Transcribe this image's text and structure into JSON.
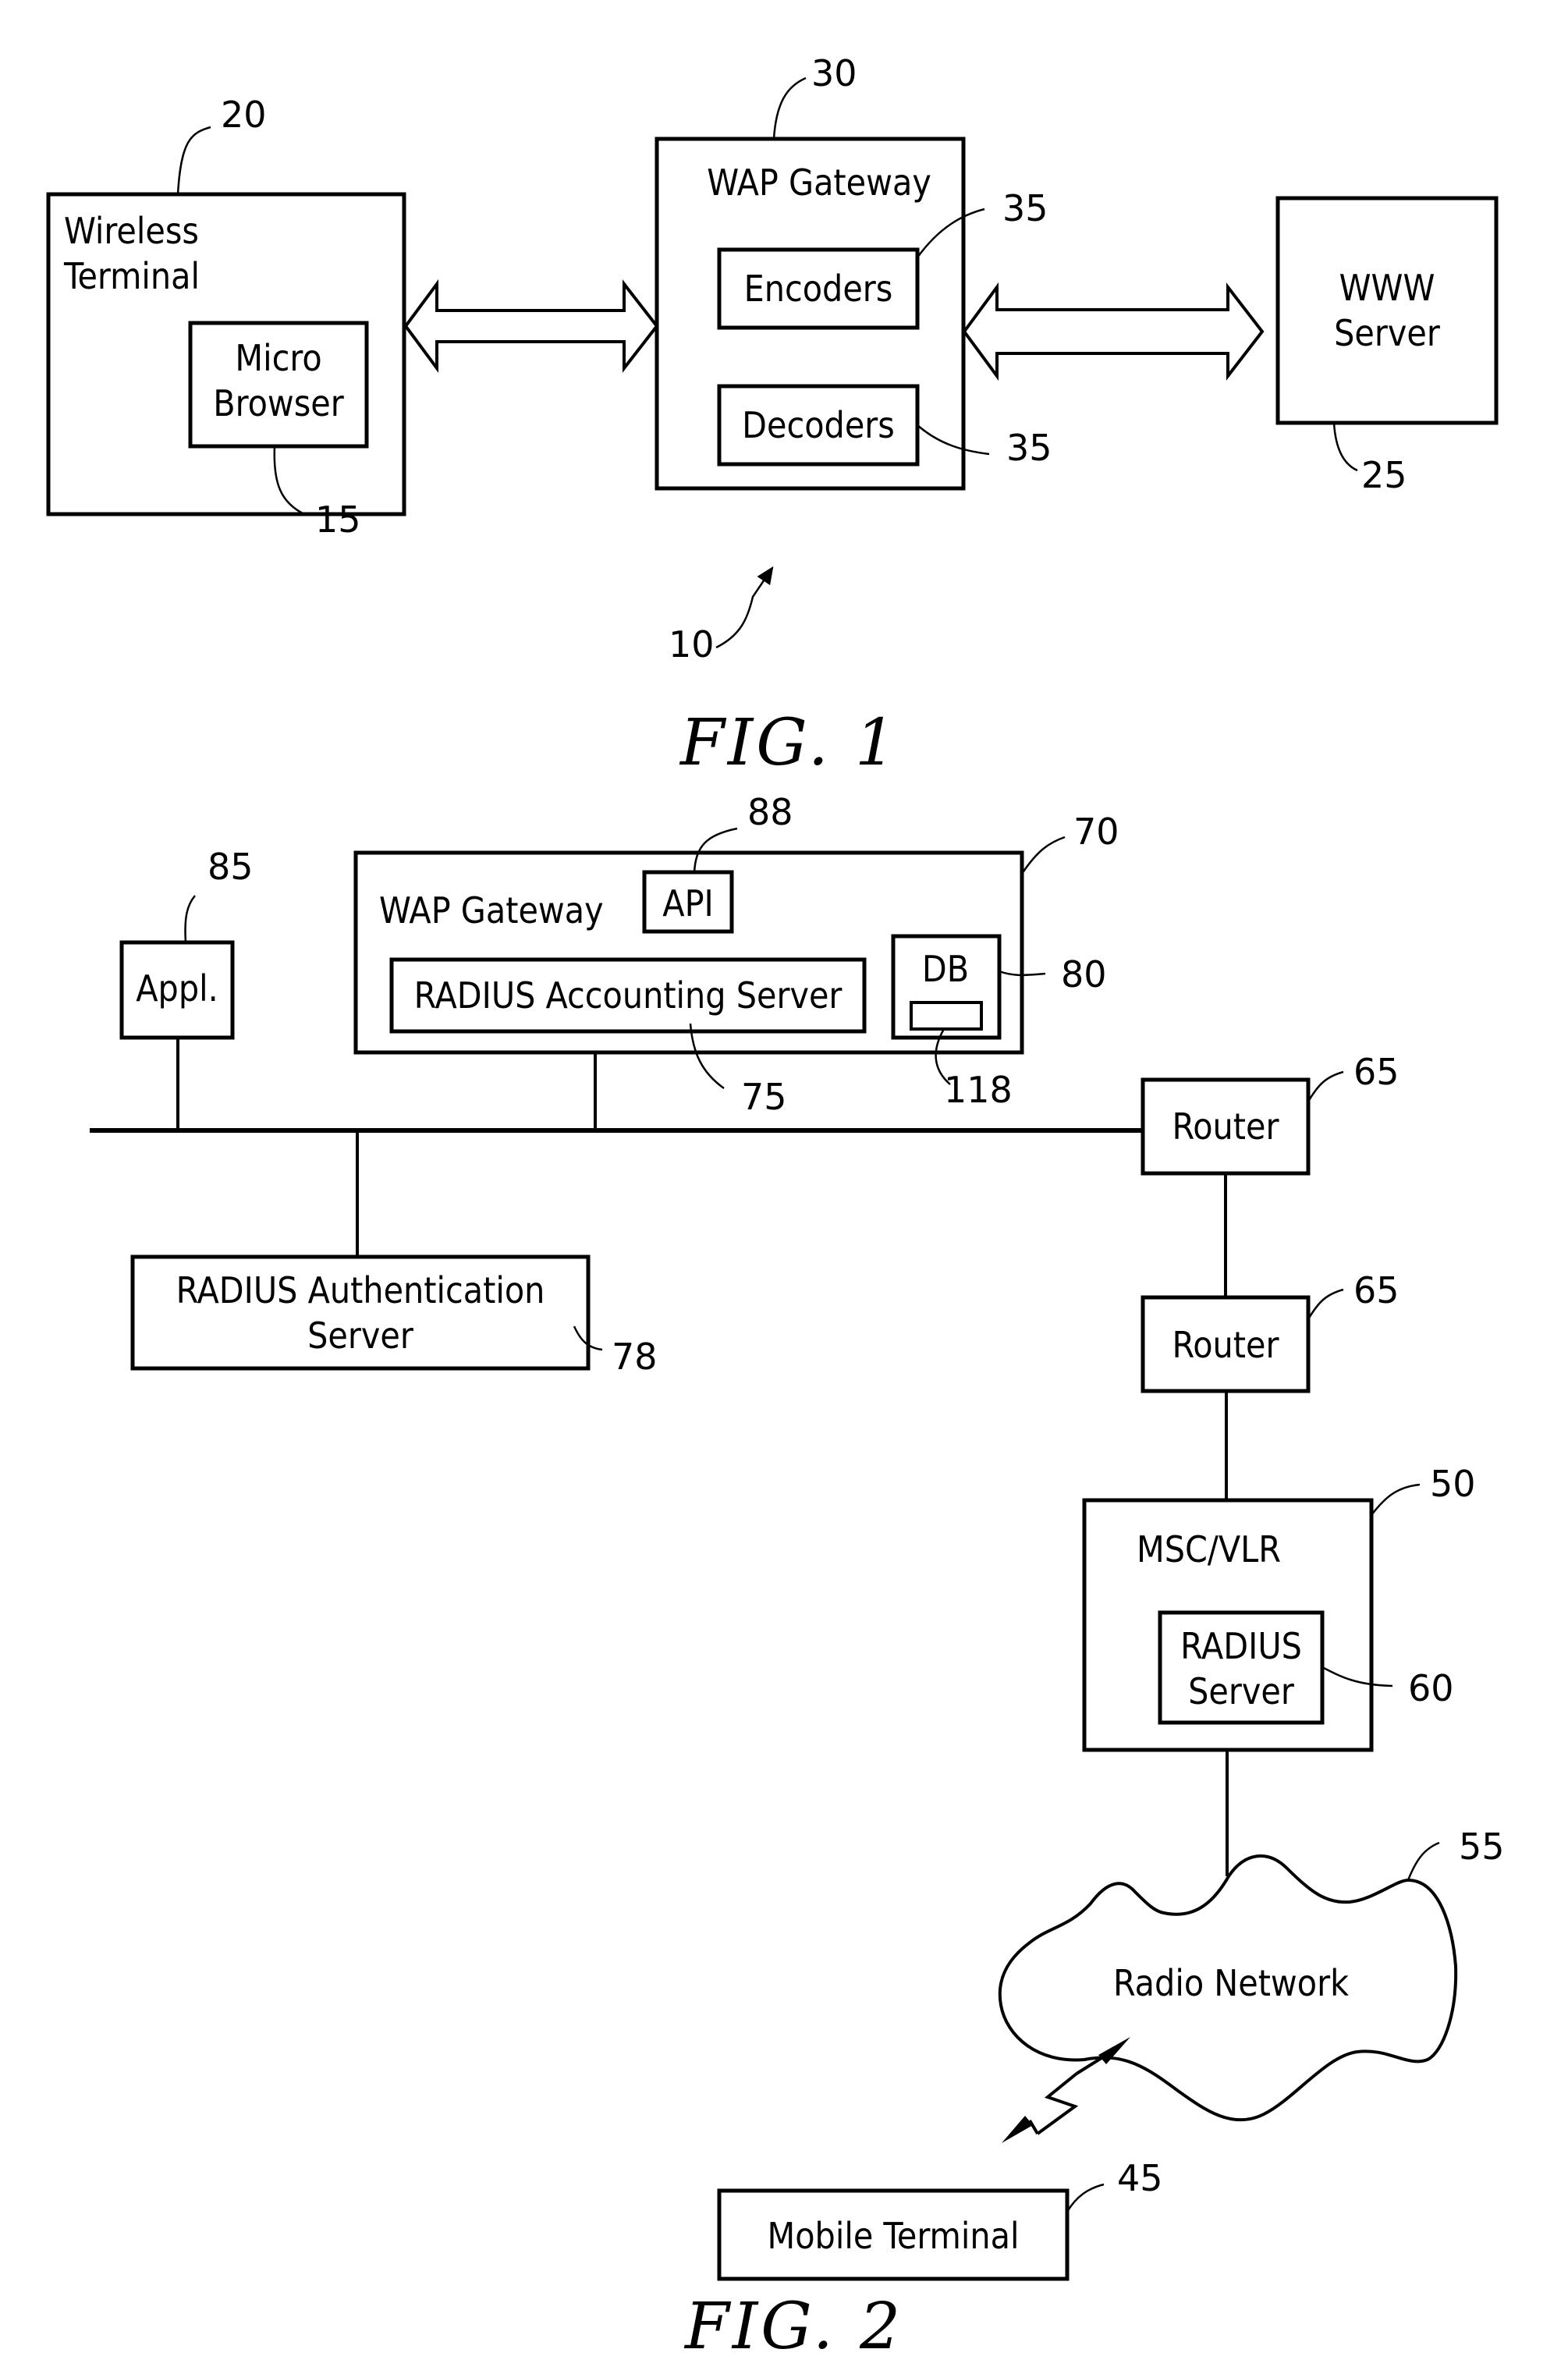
{
  "fig1": {
    "caption": "FIG. 1",
    "system_ref": "10",
    "wireless_terminal": {
      "label_line1": "Wireless",
      "label_line2": "Terminal",
      "ref": "20"
    },
    "micro_browser": {
      "label_line1": "Micro",
      "label_line2": "Browser",
      "ref": "15"
    },
    "wap_gateway": {
      "label": "WAP  Gateway",
      "ref": "30"
    },
    "encoders": {
      "label": "Encoders",
      "ref": "35"
    },
    "decoders": {
      "label": "Decoders",
      "ref": "35"
    },
    "www_server": {
      "label_line1": "WWW",
      "label_line2": "Server",
      "ref": "25"
    }
  },
  "fig2": {
    "caption": "FIG. 2",
    "application": {
      "label": "Appl.",
      "ref": "85"
    },
    "wap_gateway": {
      "label": "WAP  Gateway",
      "ref": "70"
    },
    "api": {
      "label": "API",
      "ref": "88"
    },
    "radius_accounting": {
      "label": "RADIUS  Accounting  Server",
      "ref": "75"
    },
    "db": {
      "label": "DB",
      "ref": "80",
      "record_ref": "118"
    },
    "radius_authentication": {
      "label_line1": "RADIUS  Authentication",
      "label_line2": "Server",
      "ref": "78"
    },
    "router_1": {
      "label": "Router",
      "ref": "65"
    },
    "router_2": {
      "label": "Router",
      "ref": "65"
    },
    "msc_vlr": {
      "label": "MSC/VLR",
      "ref": "50"
    },
    "radius_server": {
      "label_line1": "RADIUS",
      "label_line2": "Server",
      "ref": "60"
    },
    "radio_network": {
      "label": "Radio  Network",
      "ref": "55"
    },
    "mobile_terminal": {
      "label": "Mobile  Terminal",
      "ref": "45"
    }
  }
}
